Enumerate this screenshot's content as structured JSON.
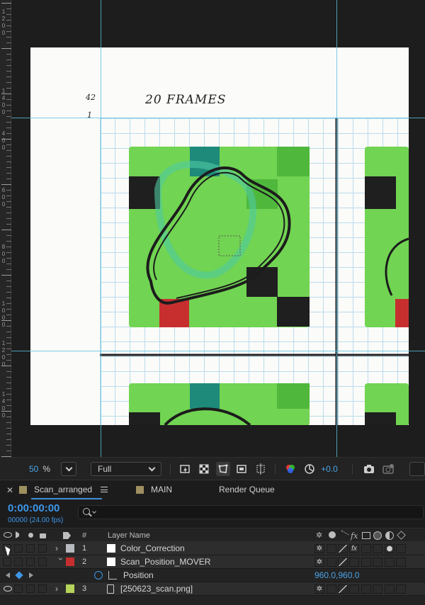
{
  "viewer": {
    "ruler_numbers": [
      "1",
      "2",
      "0",
      "0",
      "1",
      "4",
      "0",
      "0",
      "4",
      "0",
      "0",
      "6",
      "0",
      "0",
      "8",
      "0",
      "0",
      "1",
      "0",
      "0",
      "0",
      "1",
      "2",
      "0",
      "0",
      "1",
      "4",
      "0",
      "0"
    ],
    "handwriting": {
      "frame_count": "20 FRAMES",
      "note_top": "42",
      "note_bottom": "1"
    }
  },
  "toolbar": {
    "zoom_value": "50",
    "zoom_unit": "%",
    "resolution": "Full",
    "exposure_value": "+0.0",
    "icons": [
      "zoom-dropdown-icon",
      "fast-preview-icon",
      "transparency-grid-icon",
      "mask-visibility-icon",
      "region-of-interest-icon",
      "guides-icon",
      "color-channel-icon",
      "color-management-icon",
      "snapshot-icon",
      "show-snapshot-icon"
    ]
  },
  "panel_tabs": {
    "comp_tab": "Scan_arranged",
    "main_tab": "MAIN",
    "render_tab": "Render Queue",
    "comp_tab_color": "#9e9060",
    "main_tab_color": "#9e9060"
  },
  "comp": {
    "timecode": "0:00:00:00",
    "fps": "00000 (24.00 fps)",
    "search_icon": "search-icon"
  },
  "layer_header": {
    "number_col": "#",
    "name_col": "Layer Name",
    "fx_col": "fx"
  },
  "layers": [
    {
      "number": "1",
      "name": "Color_Correction",
      "label_color": "#b7babf"
    },
    {
      "number": "2",
      "name": "Scan_Position_MOVER",
      "label_color": "#c72f2f"
    },
    {
      "property": "Position",
      "value": "960.0,960.0"
    },
    {
      "number": "3",
      "name": "[250623_scan.png]",
      "label_color": "#b6d35a"
    }
  ],
  "colors": {
    "accent": "#3e96e8",
    "marker_green": "#6fd24f",
    "guide_cyan": "#5bbfe0"
  }
}
